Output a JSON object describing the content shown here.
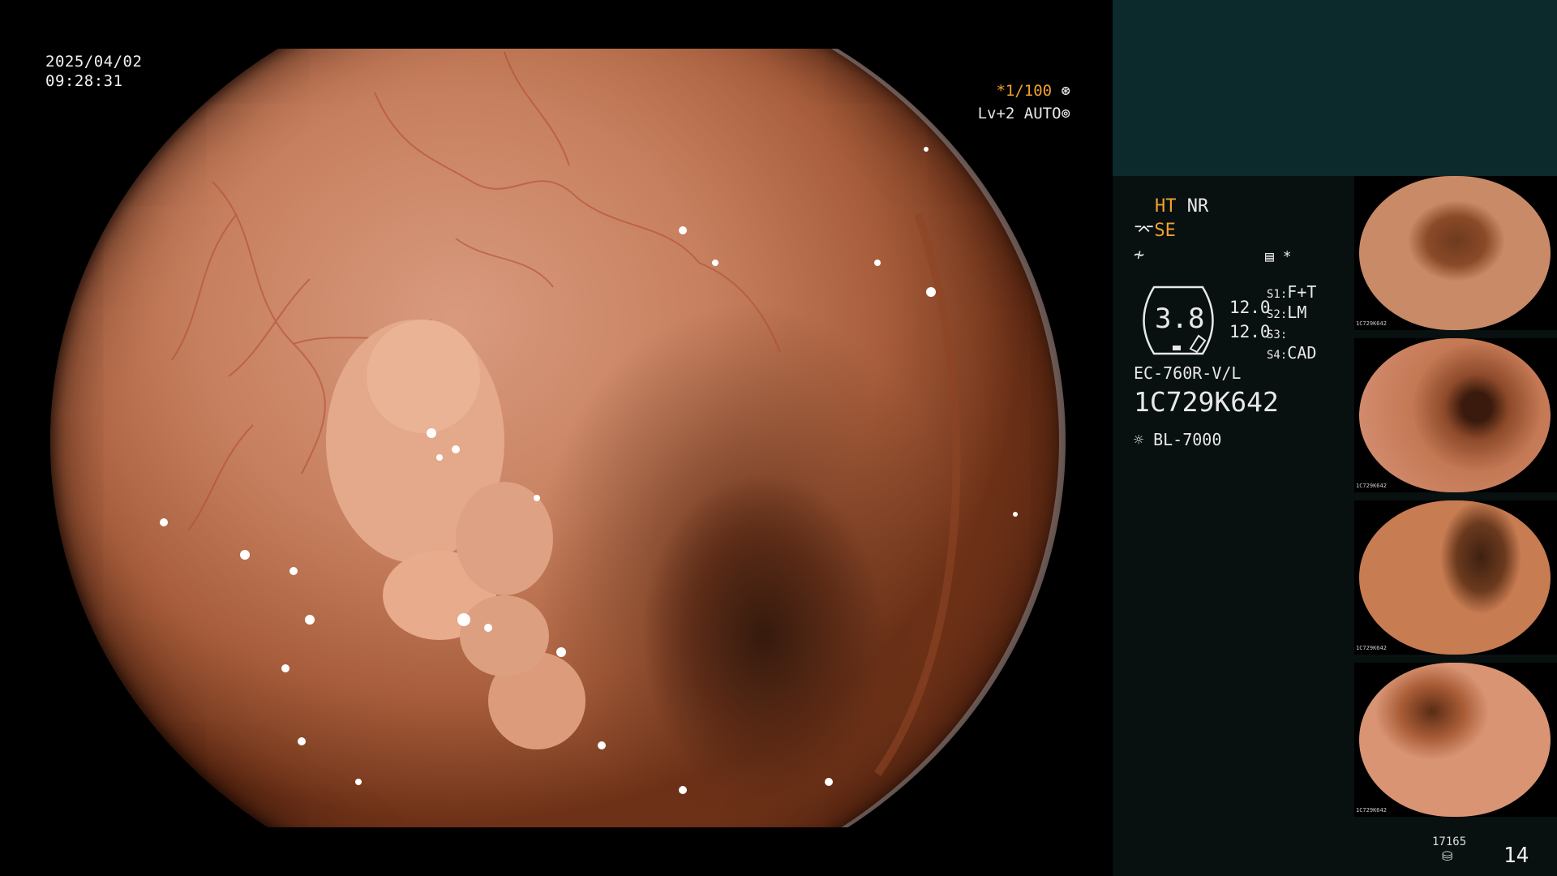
{
  "overlay": {
    "date": "2025/04/02",
    "time": "09:28:31",
    "shutter": "*1/100",
    "level": "Lv+2",
    "iris": "AUTO"
  },
  "panel": {
    "ht": "HT",
    "nr": "NR",
    "se": "SE",
    "gauge_value": "3.8",
    "value_1": "12.0",
    "value_2": "12.0",
    "s1_label": "S1:",
    "s1_value": "F+T",
    "s2_label": "S2:",
    "s2_value": "LM",
    "s3_label": "S3:",
    "s3_value": "",
    "s4_label": "S4:",
    "s4_value": "CAD",
    "scope_model": "EC-760R-V/L",
    "scope_serial": "1C729K642",
    "light_source": "BL-7000",
    "asterisk": "*"
  },
  "thumbnails": [
    {
      "serial": "1C729K642"
    },
    {
      "serial": "1C729K642"
    },
    {
      "serial": "1C729K642"
    },
    {
      "serial": "1C729K642"
    }
  ],
  "footer": {
    "count": "17165",
    "page": "14"
  },
  "colors": {
    "accent_orange": "#f0a030",
    "panel_bg": "#081010",
    "panel_top": "#0c2a2b"
  }
}
